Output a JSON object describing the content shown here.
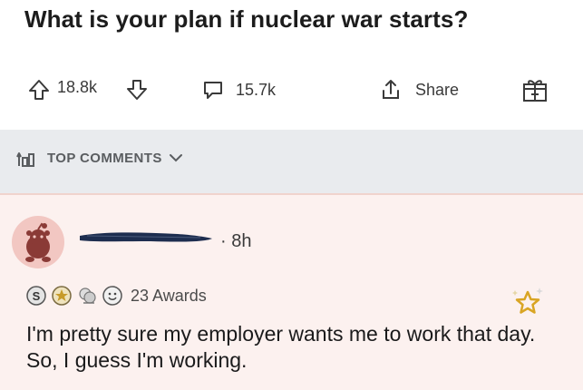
{
  "post": {
    "title": "What is your plan if nuclear war starts?",
    "score": "18.8k",
    "comments": "15.7k",
    "share": "Share"
  },
  "sort": {
    "label": "TOP COMMENTS"
  },
  "comment": {
    "timestamp": "· 8h",
    "awards_count": "23 Awards",
    "body": "I'm pretty sure my employer wants me to work that day. So, I guess I'm working."
  },
  "icons": {
    "upvote": "arrow-up-icon",
    "downvote": "arrow-down-icon",
    "comments": "speech-bubble-icon",
    "share": "share-icon",
    "gift": "gift-icon",
    "sort": "sort-icon",
    "award_button": "star-icon"
  },
  "colors": {
    "avatar_bg": "#f2c7c2",
    "comment_bg": "#fcf1ef",
    "divider_bg": "#e9ebee",
    "star_gold": "#d9a524"
  }
}
